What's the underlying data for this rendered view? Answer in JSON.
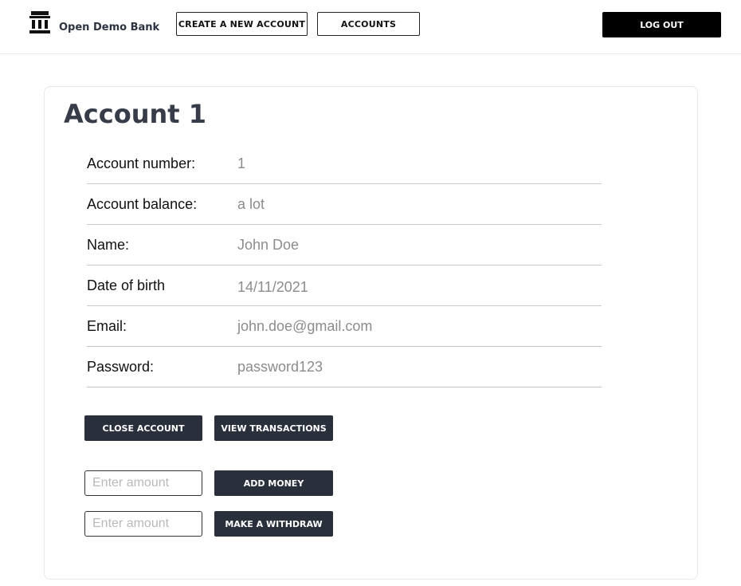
{
  "header": {
    "brand_icon": "bank-icon",
    "brand_name": "Open Demo Bank",
    "create_account_label": "CREATE A NEW ACCOUNT",
    "accounts_label": "ACCOUNTS",
    "logout_label": "LOG OUT"
  },
  "account": {
    "title": "Account 1",
    "details": [
      {
        "label": "Account number:",
        "value": "1"
      },
      {
        "label": "Account balance:",
        "value": "a lot"
      },
      {
        "label": "Name:",
        "value": "John Doe"
      },
      {
        "label": "Date of birth",
        "value": "14/11/2021"
      },
      {
        "label": "Email:",
        "value": "john.doe@gmail.com"
      },
      {
        "label": "Password:",
        "value": "password123"
      }
    ]
  },
  "actions": {
    "close_account_label": "CLOSE ACCOUNT",
    "view_transactions_label": "VIEW TRANSACTIONS",
    "add_money_placeholder": "Enter amount",
    "add_money_label": "ADD MONEY",
    "withdraw_placeholder": "Enter amount",
    "withdraw_label": "MAKE A WITHDRAW"
  },
  "colors": {
    "dark_button": "#2a303b",
    "logout_button": "#000000",
    "title_text": "#363c48",
    "value_text": "#8c8c8c"
  }
}
